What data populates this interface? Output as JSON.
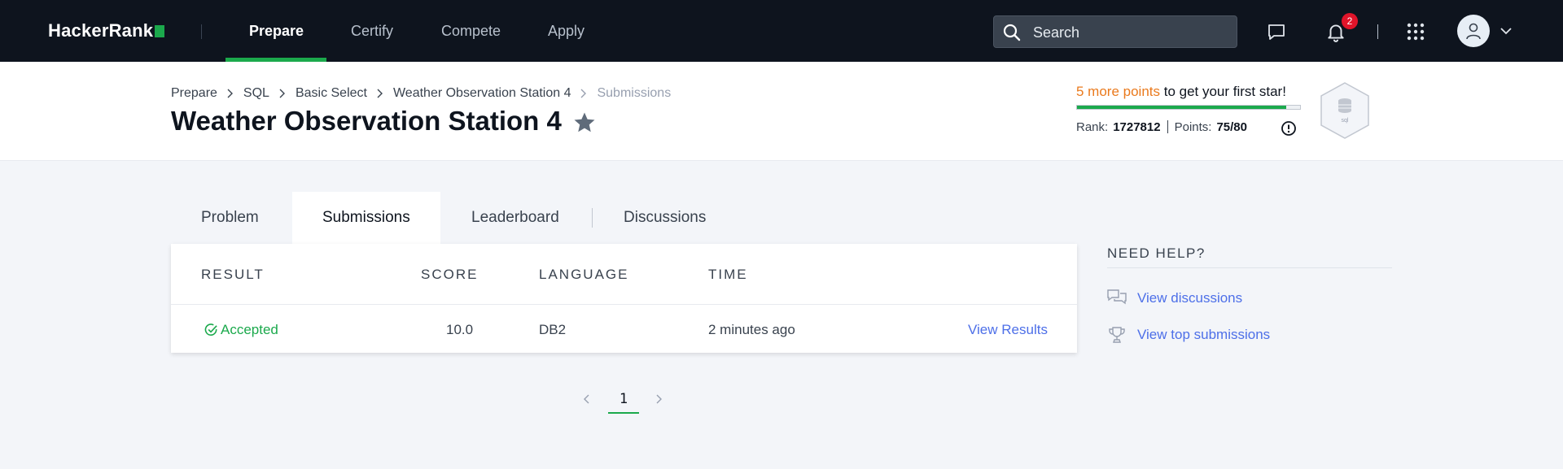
{
  "nav": {
    "logo": "HackerRank",
    "items": [
      {
        "label": "Prepare",
        "active": true
      },
      {
        "label": "Certify",
        "active": false
      },
      {
        "label": "Compete",
        "active": false
      },
      {
        "label": "Apply",
        "active": false
      }
    ],
    "search_placeholder": "Search",
    "notification_count": "2",
    "icons": [
      "search-icon",
      "chat-icon",
      "bell-icon",
      "apps-grid-icon",
      "user-icon",
      "chevron-down-icon"
    ]
  },
  "breadcrumb": [
    "Prepare",
    "SQL",
    "Basic Select",
    "Weather Observation Station 4",
    "Submissions"
  ],
  "page_title": "Weather Observation Station 4",
  "progress_card": {
    "highlight": "5 more points",
    "rest": " to get your first star!",
    "progress": 0.9375,
    "rank_label": "Rank:",
    "rank_value": "1727812",
    "points_label": "Points:",
    "points_value": "75/80",
    "badge_label": "sql"
  },
  "tabs": [
    {
      "label": "Problem",
      "active": false
    },
    {
      "label": "Submissions",
      "active": true
    },
    {
      "label": "Leaderboard",
      "active": false
    },
    {
      "label": "Discussions",
      "active": false
    }
  ],
  "table": {
    "headers": [
      "RESULT",
      "SCORE",
      "LANGUAGE",
      "TIME"
    ],
    "rows": [
      {
        "result": "Accepted",
        "score": "10.0",
        "language": "DB2",
        "time": "2 minutes ago",
        "action": "View Results"
      }
    ]
  },
  "help": {
    "title": "NEED HELP?",
    "links": [
      "View discussions",
      "View top submissions"
    ]
  },
  "pagination": {
    "current": "1"
  },
  "colors": {
    "nav_bg": "#0e141e",
    "accent_green": "#1ba94c",
    "link_blue": "#4d6fe8",
    "highlight_orange": "#ea7a1d",
    "badge_red": "#e0142a"
  }
}
